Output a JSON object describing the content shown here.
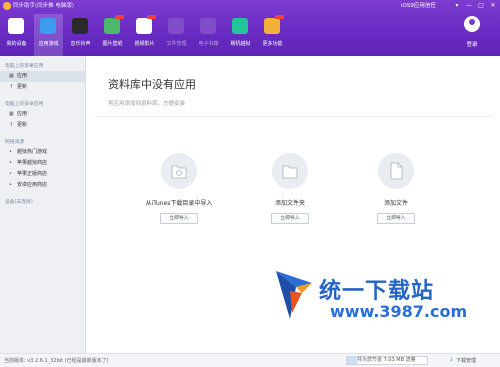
{
  "window": {
    "title": "同步助手(同步推 电脑版)",
    "ios_link": "iOS9应用信任",
    "controls": [
      "▾",
      "—",
      "□",
      "✕"
    ]
  },
  "colors": {
    "header": "#6a2cc3",
    "sidebar_bg": "#eef0f4",
    "sidebar_active": "#dce2ea",
    "accent": "#2464c6"
  },
  "nav": {
    "items": [
      {
        "label": "我的设备",
        "icon": "phone-icon",
        "color": "#ffffff",
        "state": "normal"
      },
      {
        "label": "应用游戏",
        "icon": "appstore-icon",
        "color": "#3d9bf0",
        "state": "active"
      },
      {
        "label": "音乐铃声",
        "icon": "music-disc-icon",
        "color": "#2a2a2a",
        "state": "normal"
      },
      {
        "label": "图片壁纸",
        "icon": "photo-icon",
        "color": "#4cb86a",
        "state": "new"
      },
      {
        "label": "视频影片",
        "icon": "video-icon",
        "color": "#ffffff",
        "state": "new"
      },
      {
        "label": "文件管理",
        "icon": "folder-icon",
        "color": "#8a68cc",
        "state": "dim"
      },
      {
        "label": "电子书籍",
        "icon": "book-icon",
        "color": "#8a68cc",
        "state": "dim"
      },
      {
        "label": "刷机越狱",
        "icon": "refresh-icon",
        "color": "#22c49a",
        "state": "normal"
      },
      {
        "label": "更多功能",
        "icon": "grid-icon",
        "color": "#f3b03a",
        "state": "new"
      }
    ],
    "login_label": "登录"
  },
  "sidebar": {
    "sections": [
      {
        "title": "电脑上的苹果应用",
        "items": [
          {
            "label": "应用",
            "icon": "grid-icon",
            "glyph": "▦",
            "active": true
          },
          {
            "label": "更新",
            "icon": "arrow-up-icon",
            "glyph": "↑",
            "active": false
          }
        ]
      },
      {
        "title": "电脑上的安卓应用",
        "items": [
          {
            "label": "应用",
            "icon": "grid-icon",
            "glyph": "▦",
            "active": false
          },
          {
            "label": "更新",
            "icon": "arrow-up-icon",
            "glyph": "↑",
            "active": false
          }
        ]
      },
      {
        "title": "网络资源",
        "items": [
          {
            "label": "越狱热门游戏",
            "icon": "dot-icon",
            "glyph": "•",
            "active": false
          },
          {
            "label": "苹果越狱商店",
            "icon": "dot-icon",
            "glyph": "•",
            "active": false
          },
          {
            "label": "苹果正版商店",
            "icon": "dot-icon",
            "glyph": "•",
            "active": false
          },
          {
            "label": "安卓应用商店",
            "icon": "dot-icon",
            "glyph": "•",
            "active": false
          }
        ]
      },
      {
        "title": "设备(未连接)",
        "items": []
      }
    ]
  },
  "main": {
    "title": "资料库中没有应用",
    "subtitle": "将应用添加到资料库，方便安装",
    "options": [
      {
        "label": "从iTunes下载目录中导入",
        "button": "立即导入",
        "icon": "itunes-folder-icon"
      },
      {
        "label": "添加文件夹",
        "button": "立即导入",
        "icon": "folder-icon"
      },
      {
        "label": "添加文件",
        "button": "立即导入",
        "icon": "file-icon"
      }
    ]
  },
  "watermark": {
    "name": "统一下载站",
    "url": "www.3987.com"
  },
  "status": {
    "version": "当前版本: v3.2.6.1_32bit  (已经是最新版本了)",
    "storage": "共为您节省 7.03 MB 流量",
    "storage_fraction": 0.12,
    "download_label": "下载管理"
  }
}
